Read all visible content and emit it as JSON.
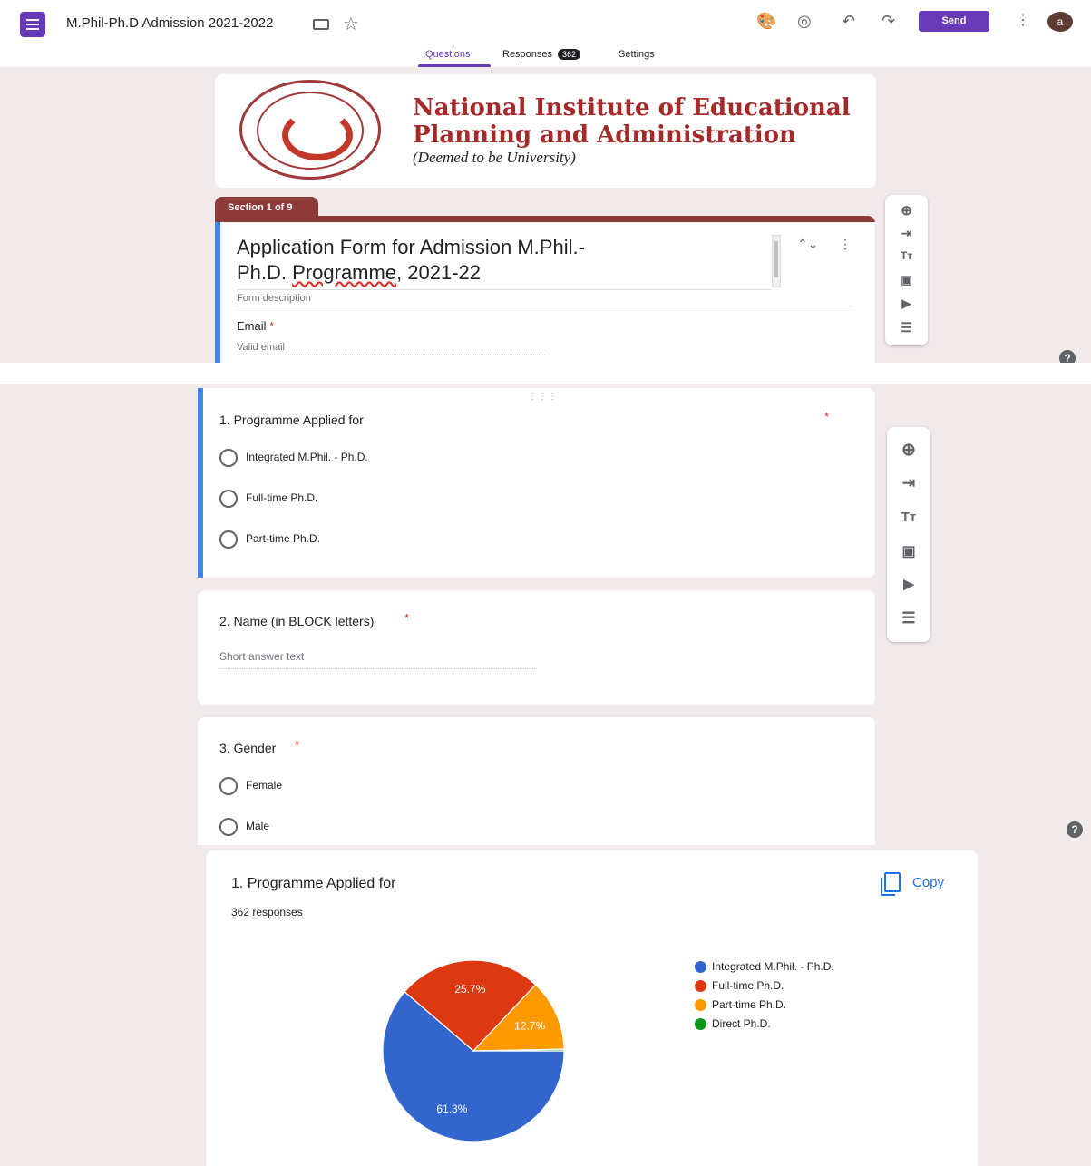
{
  "header": {
    "doc_title": "M.Phil-Ph.D Admission 2021-2022",
    "send_label": "Send",
    "avatar_initial": "a",
    "tabs": [
      {
        "label": "Questions",
        "active": true
      },
      {
        "label": "Responses",
        "badge": "362"
      },
      {
        "label": "Settings"
      }
    ],
    "icons": [
      "palette-icon",
      "preview-eye-icon",
      "undo-icon",
      "redo-icon",
      "more-vert-icon"
    ]
  },
  "banner": {
    "line1": "National Institute of Educational",
    "line2": "Planning and Administration",
    "line3": "(Deemed to be University)"
  },
  "section_label": "Section 1 of 9",
  "form": {
    "title_line1": "Application Form for Admission M.Phil.-",
    "title_line2_pre": "Ph.D. ",
    "title_line2_ul": "Programme",
    "title_line2_post": ", 2021-22",
    "description_placeholder": "Form description",
    "email_label": "Email",
    "email_placeholder": "Valid email"
  },
  "questions": [
    {
      "title": "1. Programme Applied for",
      "options": [
        "Integrated M.Phil. - Ph.D.",
        "Full-time Ph.D.",
        "Part-time Ph.D."
      ]
    },
    {
      "title": "2. Name (in BLOCK letters)",
      "placeholder": "Short answer text"
    },
    {
      "title": "3. Gender",
      "options": [
        "Female",
        "Male"
      ]
    }
  ],
  "toolbar_icons": [
    "add-question-icon",
    "import-questions-icon",
    "add-title-icon",
    "add-image-icon",
    "add-video-icon",
    "add-section-icon"
  ],
  "required_mark": "*",
  "help_label": "?",
  "response_summary": {
    "title": "1. Programme Applied for",
    "count": "362 responses",
    "copy_label": "Copy"
  },
  "colors": {
    "accent": "#673ab7",
    "header_bar": "#8d3a39",
    "blue": "#3366cc",
    "red": "#dc3912",
    "orange": "#ff9900",
    "green": "#109618"
  },
  "chart_data": {
    "type": "pie",
    "categories": [
      "Integrated M.Phil. - Ph.D.",
      "Full-time Ph.D.",
      "Part-time Ph.D.",
      "Direct Ph.D."
    ],
    "values": [
      61.3,
      25.7,
      12.7,
      0.3
    ],
    "slice_labels": [
      "61.3%",
      "25.7%",
      "12.7%",
      ""
    ],
    "colors": [
      "#3366cc",
      "#dc3912",
      "#ff9900",
      "#109618"
    ],
    "legend": "right"
  }
}
